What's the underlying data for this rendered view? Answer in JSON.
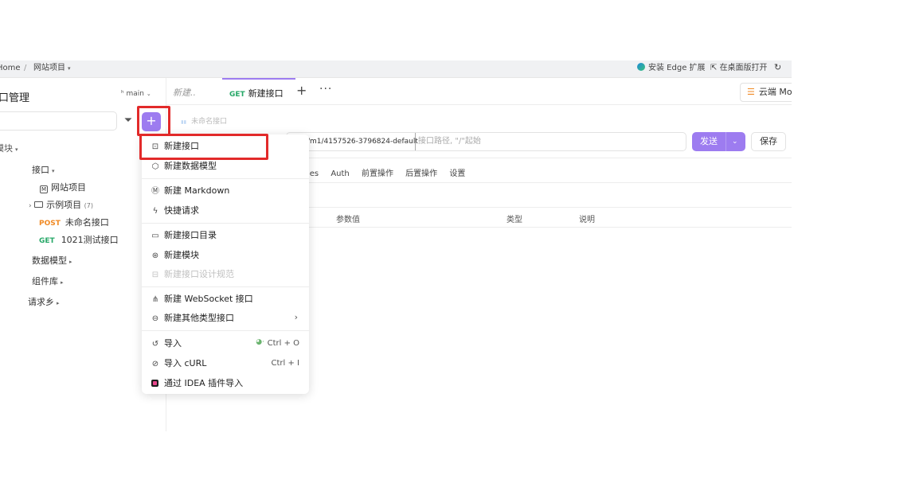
{
  "browser": {
    "breadcrumb_home": "Home",
    "breadcrumb_sep": "/",
    "breadcrumb_project": "网站项目",
    "edge_ext": "安装 Edge 扩展",
    "open_desktop": "在桌面版打开"
  },
  "sidebar": {
    "title": "口管理",
    "branch": "main",
    "items": [
      {
        "label": "模块"
      },
      {
        "label": "接口"
      },
      {
        "label": "网站项目"
      },
      {
        "label": "示例项目",
        "count": "(7)"
      },
      {
        "method": "POST",
        "label": "未命名接口"
      },
      {
        "method": "GET",
        "label": "1021测试接口"
      },
      {
        "label": "数据模型"
      },
      {
        "label": "组件库"
      },
      {
        "label": "请求乡"
      }
    ]
  },
  "tabs": {
    "draft": "新建..",
    "active_method": "GET",
    "active_label": "新建接口",
    "add": "+",
    "more": "···",
    "cloud": "云端 Mo"
  },
  "request": {
    "name_placeholder": "未命名接口",
    "url_prefix": "/m1/4157526-3796824-default",
    "url_placeholder": "接口路径, \"/\"起始",
    "send": "发送",
    "save": "保存",
    "subtabs": [
      "ies",
      "Auth",
      "前置操作",
      "后置操作",
      "设置"
    ],
    "table_headers": [
      "参数值",
      "类型",
      "说明"
    ]
  },
  "menu": {
    "items": [
      {
        "label": "新建接口",
        "icon": "api-icon"
      },
      {
        "label": "新建数据模型",
        "icon": "cube-icon"
      },
      {
        "label": "新建 Markdown",
        "icon": "markdown-icon"
      },
      {
        "label": "快捷请求",
        "icon": "lightning-icon"
      },
      {
        "label": "新建接口目录",
        "icon": "folder-icon"
      },
      {
        "label": "新建模块",
        "icon": "module-icon"
      },
      {
        "label": "新建接口设计规范",
        "icon": "spec-icon",
        "disabled": true
      },
      {
        "label": "新建 WebSocket 接口",
        "icon": "websocket-icon"
      },
      {
        "label": "新建其他类型接口",
        "icon": "other-icon"
      },
      {
        "label": "导入",
        "icon": "import-icon",
        "shortcut": "Ctrl + O"
      },
      {
        "label": "导入 cURL",
        "icon": "curl-icon",
        "shortcut": "Ctrl + I"
      },
      {
        "label": "通过 IDEA 插件导入",
        "icon": "idea-icon"
      }
    ]
  },
  "colors": {
    "accent": "#9d7cf0",
    "highlight": "#e22a2a",
    "post": "#f08a24",
    "get": "#27a868"
  }
}
